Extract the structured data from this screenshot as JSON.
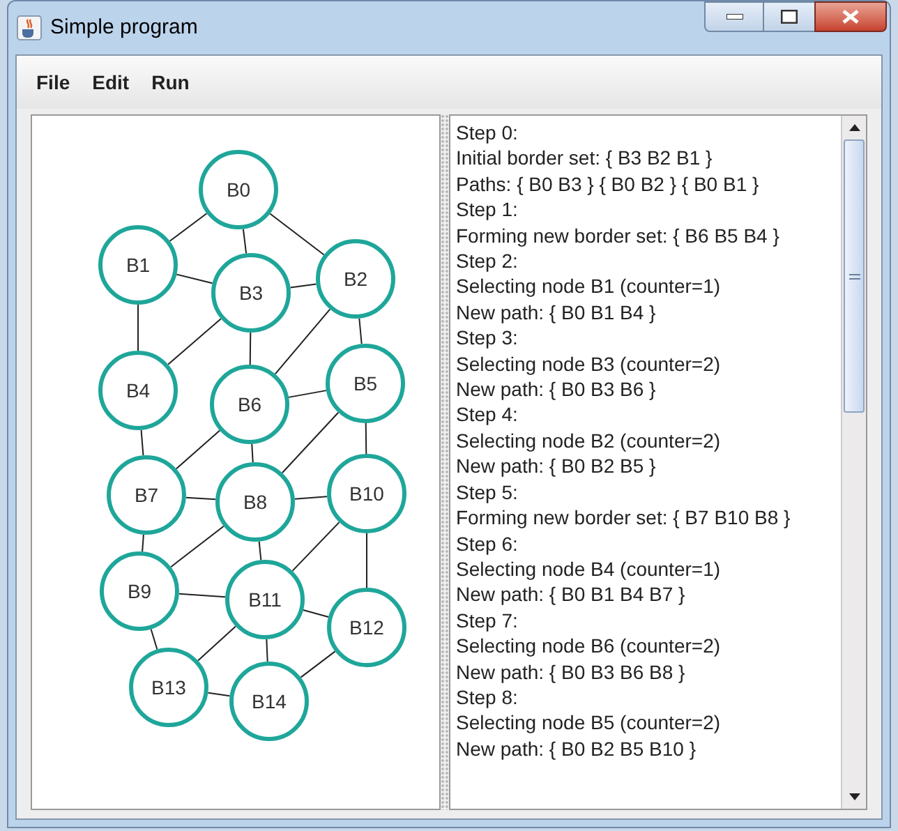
{
  "window": {
    "title": "Simple program"
  },
  "menu": [
    "File",
    "Edit",
    "Run"
  ],
  "graph": {
    "nodes": [
      "B0",
      "B1",
      "B2",
      "B3",
      "B4",
      "B5",
      "B6",
      "B7",
      "B8",
      "B9",
      "B10",
      "B11",
      "B12",
      "B13",
      "B14"
    ]
  },
  "log": [
    "Step 0:",
    "Initial border set: { B3 B2 B1 }",
    "Paths: { B0 B3 } { B0 B2 } { B0 B1 }",
    "Step 1:",
    "Forming new border set: { B6 B5 B4 }",
    "Step 2:",
    "Selecting node B1 (counter=1)",
    "New path: { B0 B1 B4 }",
    "Step 3:",
    "Selecting node B3 (counter=2)",
    "New path: { B0 B3 B6 }",
    "Step 4:",
    "Selecting node B2 (counter=2)",
    "New path: { B0 B2 B5 }",
    "Step 5:",
    "Forming new border set: { B7 B10 B8 }",
    "Step 6:",
    "Selecting node B4 (counter=1)",
    "New path: { B0 B1 B4 B7 }",
    "Step 7:",
    "Selecting node B6 (counter=2)",
    "New path: { B0 B3 B6 B8 }",
    "Step 8:",
    "Selecting node B5 (counter=2)",
    "New path: { B0 B2 B5 B10 }"
  ]
}
